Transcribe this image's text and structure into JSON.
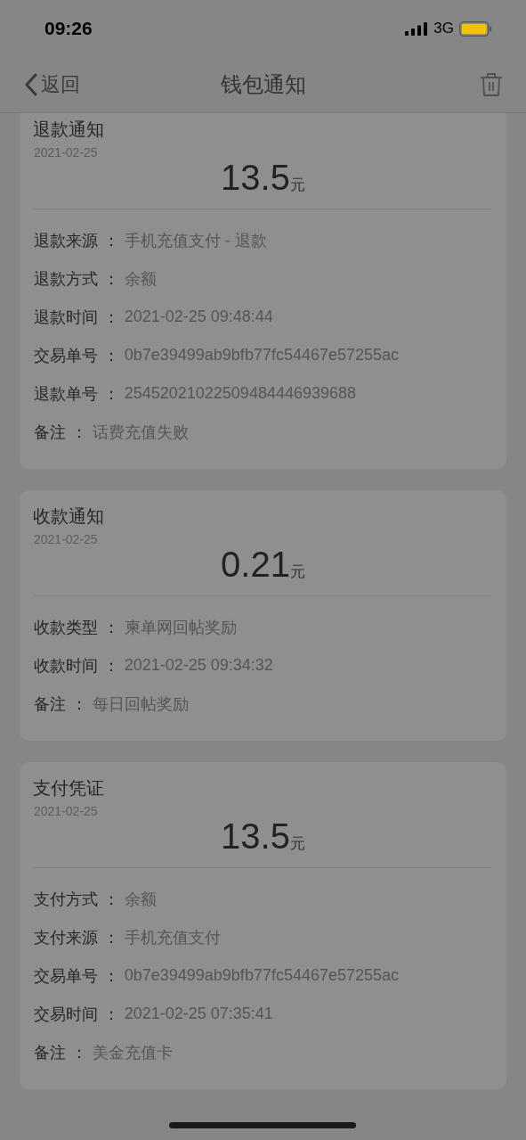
{
  "status_bar": {
    "time": "09:26",
    "network": "3G"
  },
  "nav_bar": {
    "back_label": "返回",
    "title": "钱包通知"
  },
  "notifications": [
    {
      "title": "退款通知",
      "date": "2021-02-25",
      "amount": "13.5",
      "unit": "元",
      "fields": [
        {
          "label": "退款来源 ：",
          "value": "手机充值支付 - 退款"
        },
        {
          "label": "退款方式 ：",
          "value": "余额"
        },
        {
          "label": "退款时间 ：",
          "value": "2021-02-25 09:48:44"
        },
        {
          "label": "交易单号 ：",
          "value": "0b7e39499ab9bfb77fc54467e57255ac"
        },
        {
          "label": "退款单号 ：",
          "value": "25452021022509484446939688"
        },
        {
          "label": "备注 ：",
          "value": "话费充值失败"
        }
      ]
    },
    {
      "title": "收款通知",
      "date": "2021-02-25",
      "amount": "0.21",
      "unit": "元",
      "fields": [
        {
          "label": "收款类型 ：",
          "value": "柬单网回帖奖励"
        },
        {
          "label": "收款时间 ：",
          "value": "2021-02-25 09:34:32"
        },
        {
          "label": "备注 ：",
          "value": "每日回帖奖励"
        }
      ]
    },
    {
      "title": "支付凭证",
      "date": "2021-02-25",
      "amount": "13.5",
      "unit": "元",
      "fields": [
        {
          "label": "支付方式 ：",
          "value": "余额"
        },
        {
          "label": "支付来源 ：",
          "value": "手机充值支付"
        },
        {
          "label": "交易单号 ：",
          "value": "0b7e39499ab9bfb77fc54467e57255ac"
        },
        {
          "label": "交易时间 ：",
          "value": "2021-02-25 07:35:41"
        },
        {
          "label": "备注 ：",
          "value": "美金充值卡"
        }
      ]
    }
  ]
}
